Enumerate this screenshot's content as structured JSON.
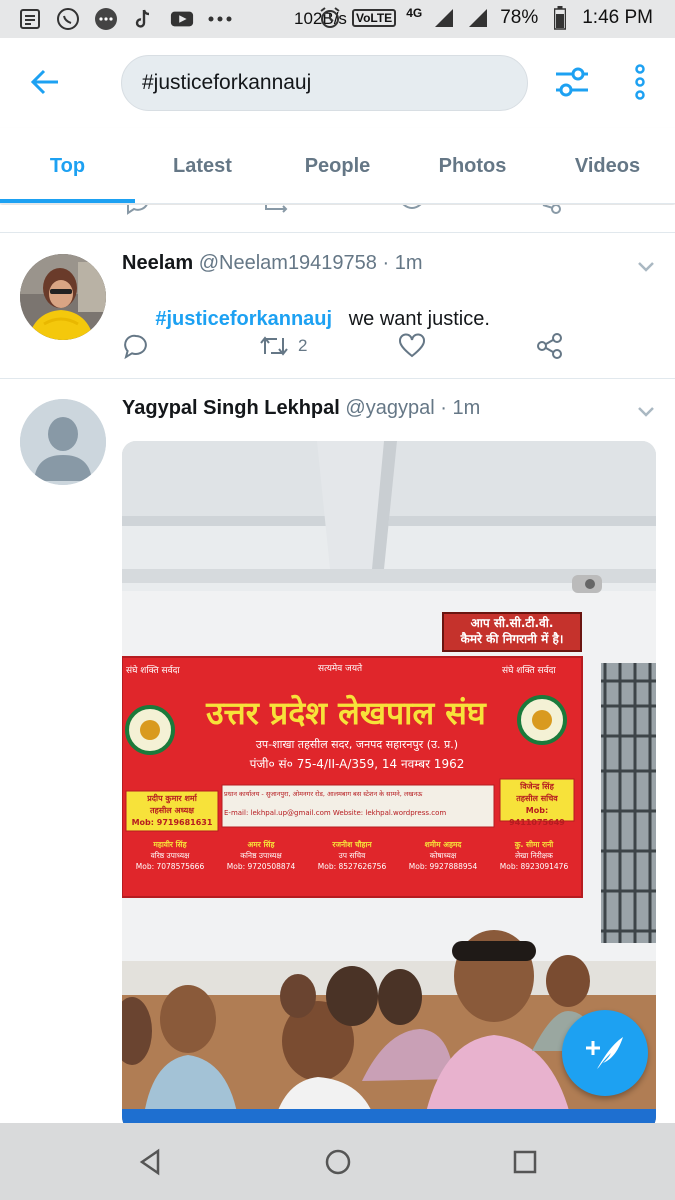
{
  "status_bar": {
    "network_speed": "102B/s",
    "volte": "VoLTE",
    "network_type": "4G",
    "battery": "78%",
    "time": "1:46 PM"
  },
  "search": {
    "query": "#justiceforkannauj"
  },
  "tabs": [
    {
      "label": "Top",
      "active": true
    },
    {
      "label": "Latest",
      "active": false
    },
    {
      "label": "People",
      "active": false
    },
    {
      "label": "Photos",
      "active": false
    },
    {
      "label": "Videos",
      "active": false
    }
  ],
  "tweets": [
    {
      "name": "Neelam",
      "handle": "@Neelam19419758",
      "separator": "·",
      "time": "1m",
      "hashtag": "#justiceforkannauj",
      "text": "   we want justice.",
      "retweets": "2"
    },
    {
      "name": "Yagypal Singh Lekhpal",
      "handle": "@yagypal",
      "separator": "·",
      "time": "1m",
      "media": {
        "cctv_sign": [
          "आप सी.सी.टी.वी.",
          "कैमरे की निगरानी में है।"
        ],
        "banner_small_left": "संघे शक्ति सर्वदा",
        "banner_small_center": "सत्यमेव जयते",
        "banner_small_right": "संघे शक्ति सर्वदा",
        "banner_title": "उत्तर प्रदेश लेखपाल संघ",
        "banner_sub1": "उप-शाखा तहसील सदर, जनपद सहारनपुर (उ. प्र.)",
        "banner_sub2": "पंजी० सं० 75-4/II-A/359, 14 नवम्बर 1962",
        "banner_office": "प्रधान कार्यालय - सुजानपुरा, ओमनगर रोड, आलमबाग बस स्टेशन के सामने, लखनऊ",
        "banner_contact": "E-mail: lekhpal.up@gmail.com    Website: lekhpal.wordpress.com",
        "left_box": [
          "प्रदीप कुमार शर्मा",
          "तहसील अध्यक्ष",
          "Mob: 9719681631"
        ],
        "right_box": [
          "विजेन्द्र सिंह",
          "तहसील सचिव",
          "Mob: 9411075649"
        ],
        "members": [
          [
            "महावीर सिंह",
            "वरिष्ठ उपाध्यक्ष",
            "Mob: 7078575666"
          ],
          [
            "अमर सिंह",
            "कनिष्ठ उपाध्यक्ष",
            "Mob: 9720508874"
          ],
          [
            "रजनीश चौहान",
            "उप सचिव",
            "Mob: 8527626756"
          ],
          [
            "शमीम अहमद",
            "कोषाध्यक्ष",
            "Mob: 9927888954"
          ],
          [
            "कु. सीमा रानी",
            "लेखा निरीक्षक",
            "Mob: 8923091476"
          ]
        ]
      }
    }
  ],
  "colors": {
    "accent": "#1da1f2",
    "secondary_text": "#657786",
    "banner_red": "#e0262b",
    "banner_yellow": "#f7e23a"
  }
}
